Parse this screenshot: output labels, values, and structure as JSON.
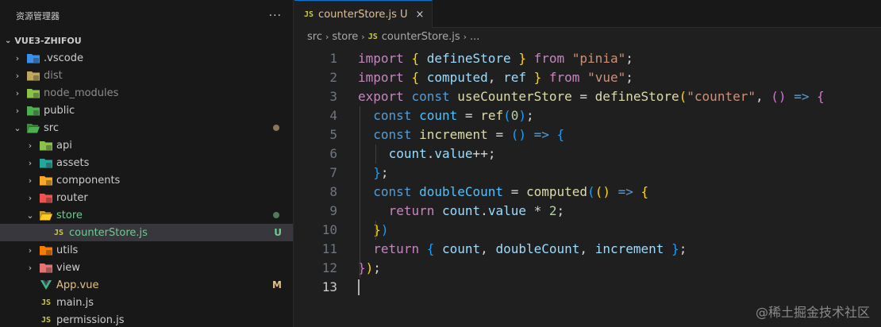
{
  "explorer": {
    "title": "资源管理器",
    "more": "···",
    "project": "VUE3-ZHIFOU",
    "items": [
      {
        "label": ".vscode",
        "chev": "›",
        "icon": "vscode-folder-icon",
        "color": "#cccccc"
      },
      {
        "label": "dist",
        "chev": "›",
        "icon": "dist-folder-icon",
        "color": "#8c8c8c"
      },
      {
        "label": "node_modules",
        "chev": "›",
        "icon": "node-folder-icon",
        "color": "#8c8c8c"
      },
      {
        "label": "public",
        "chev": "›",
        "icon": "public-folder-icon",
        "color": "#cccccc"
      },
      {
        "label": "src",
        "chev": "⌄",
        "icon": "src-folder-icon",
        "color": "#cccccc"
      },
      {
        "label": "api",
        "chev": "›",
        "icon": "api-folder-icon",
        "color": "#cccccc"
      },
      {
        "label": "assets",
        "chev": "›",
        "icon": "assets-folder-icon",
        "color": "#cccccc"
      },
      {
        "label": "components",
        "chev": "›",
        "icon": "components-folder-icon",
        "color": "#cccccc"
      },
      {
        "label": "router",
        "chev": "›",
        "icon": "router-folder-icon",
        "color": "#cccccc"
      },
      {
        "label": "store",
        "chev": "⌄",
        "icon": "store-folder-icon",
        "color": "#73c991"
      },
      {
        "label": "counterStore.js",
        "chev": "",
        "icon": "js-file-icon",
        "color": "#73c991",
        "deco": "U"
      },
      {
        "label": "utils",
        "chev": "›",
        "icon": "utils-folder-icon",
        "color": "#cccccc"
      },
      {
        "label": "view",
        "chev": "›",
        "icon": "view-folder-icon",
        "color": "#cccccc"
      },
      {
        "label": "App.vue",
        "chev": "",
        "icon": "vue-file-icon",
        "color": "#e2c08d",
        "deco": "M"
      },
      {
        "label": "main.js",
        "chev": "",
        "icon": "js-file-icon",
        "color": "#cccccc"
      },
      {
        "label": "permission.js",
        "chev": "",
        "icon": "js-file-icon",
        "color": "#cccccc"
      }
    ]
  },
  "tab": {
    "icon_text": "JS",
    "name": "counterStore.js",
    "status": "U",
    "close": "×"
  },
  "breadcrumb": {
    "parts": [
      "src",
      "store"
    ],
    "file": "counterStore.js",
    "more": "..."
  },
  "code": {
    "line_numbers": [
      "1",
      "2",
      "3",
      "4",
      "5",
      "6",
      "7",
      "8",
      "9",
      "10",
      "11",
      "12",
      "13"
    ],
    "lines": [
      "import { defineStore } from \"pinia\";",
      "import { computed, ref } from \"vue\";",
      "export const useCounterStore = defineStore(\"counter\", () => {",
      "  const count = ref(0);",
      "  const increment = () => {",
      "    count.value++;",
      "  };",
      "  const doubleCount = computed(() => {",
      "    return count.value * 2;",
      "  })",
      "  return { count, doubleCount, increment };",
      "});",
      ""
    ]
  },
  "watermark": "@稀土掘金技术社区",
  "colors": {
    "accent": "#0078d4",
    "untracked": "#73c991",
    "modified": "#e2c08d"
  }
}
